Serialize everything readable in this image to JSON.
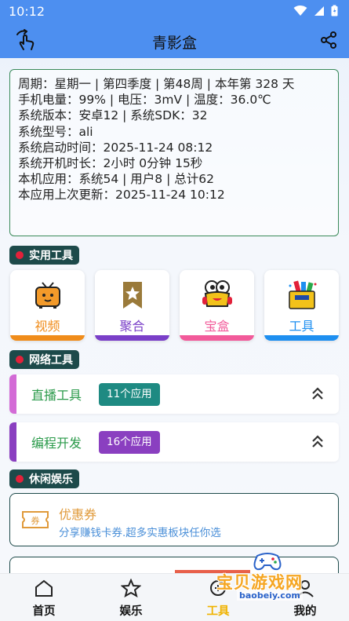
{
  "status_bar": {
    "time": "10:12"
  },
  "app_bar": {
    "title": "青影盒"
  },
  "info_card": {
    "lines": [
      "周期：星期一 | 第四季度 | 第48周 | 本年第 328 天",
      "手机电量：99% | 电压：3mV | 温度：36.0℃",
      "系统版本：安卓12 | 系统SDK：32",
      "系统型号：ali",
      "系统启动时间：2025-11-24 08:12",
      "系统开机时长：2小时 0分钟 15秒",
      "本机应用：系统54 | 用户8 | 总计62",
      "本应用上次更新：2025-11-24 10:12"
    ]
  },
  "sections": {
    "tools": "实用工具",
    "network": "网络工具",
    "leisure": "休闲娱乐"
  },
  "tiles": [
    {
      "label": "视频",
      "icon": "tv-icon",
      "color": "#f08c1a"
    },
    {
      "label": "聚合",
      "icon": "bookmark-star-icon",
      "color": "#7a3fc8"
    },
    {
      "label": "宝盒",
      "icon": "mascot-icon",
      "color": "#f25a9a"
    },
    {
      "label": "工具",
      "icon": "toolbox-icon",
      "color": "#1e8ff0"
    }
  ],
  "network_rows": [
    {
      "name": "直播工具",
      "badge": "11个应用",
      "accent": "#d36bd6",
      "badge_color": "#1e8a82"
    },
    {
      "name": "编程开发",
      "badge": "16个应用",
      "accent": "#8a3fc0",
      "badge_color": "#8a3fc0"
    }
  ],
  "coupon": {
    "title": "优惠券",
    "subtitle": "分享赚钱卡券.超多实惠板块任你选",
    "icon_text": "券"
  },
  "bottom_nav": [
    {
      "label": "首页",
      "icon": "home-icon"
    },
    {
      "label": "娱乐",
      "icon": "star-icon"
    },
    {
      "label": "工具",
      "icon": "tools-icon",
      "active": true
    },
    {
      "label": "我的",
      "icon": "user-icon"
    }
  ],
  "watermark": {
    "title": "宝贝游戏网",
    "url": "baobeiy.com"
  }
}
